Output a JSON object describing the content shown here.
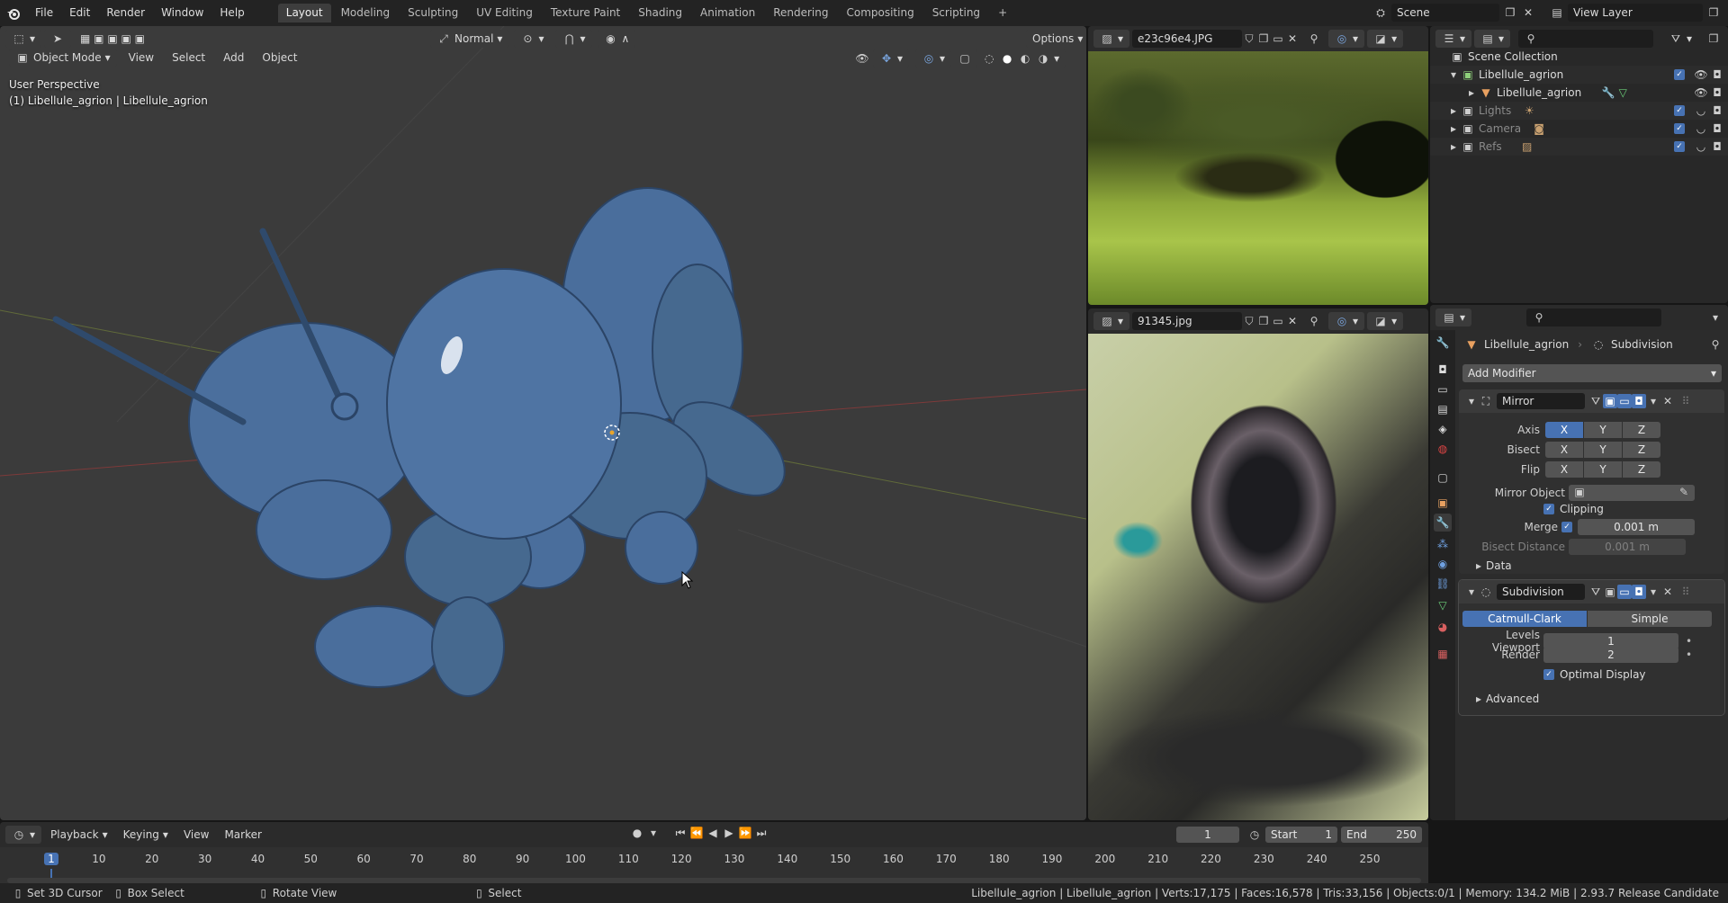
{
  "topbar": {
    "menu": [
      "File",
      "Edit",
      "Render",
      "Window",
      "Help"
    ],
    "workspaces": [
      "Layout",
      "Modeling",
      "Sculpting",
      "UV Editing",
      "Texture Paint",
      "Shading",
      "Animation",
      "Rendering",
      "Compositing",
      "Scripting"
    ],
    "active_workspace": "Layout",
    "add_tab": "+",
    "scene": "Scene",
    "view_layer": "View Layer"
  },
  "viewport": {
    "mode": "Object Mode",
    "menus": [
      "View",
      "Select",
      "Add",
      "Object"
    ],
    "orientation": "Normal",
    "options": "Options",
    "overlay_line1": "User Perspective",
    "overlay_line2": "(1) Libellule_agrion | Libellule_agrion"
  },
  "image_editor_top": {
    "filename": "e23c96e4.JPG"
  },
  "image_editor_bottom": {
    "filename": "91345.jpg"
  },
  "outliner": {
    "root": "Scene Collection",
    "items": [
      {
        "name": "Libellule_agrion",
        "kind": "collection"
      },
      {
        "name": "Libellule_agrion",
        "kind": "object"
      },
      {
        "name": "Lights",
        "kind": "collection"
      },
      {
        "name": "Camera",
        "kind": "collection"
      },
      {
        "name": "Refs",
        "kind": "collection"
      }
    ]
  },
  "properties": {
    "object_name": "Libellule_agrion",
    "modifier_context": "Subdivision",
    "add_modifier": "Add Modifier",
    "mirror": {
      "name": "Mirror",
      "axis_label": "Axis",
      "bisect_label": "Bisect",
      "flip_label": "Flip",
      "axes": [
        "X",
        "Y",
        "Z"
      ],
      "mirror_object_label": "Mirror Object",
      "clipping_label": "Clipping",
      "merge_label": "Merge",
      "merge_value": "0.001 m",
      "bisect_distance_label": "Bisect Distance",
      "bisect_distance_value": "0.001 m",
      "data_label": "Data"
    },
    "subdivision": {
      "name": "Subdivision",
      "catmull": "Catmull-Clark",
      "simple": "Simple",
      "levels_viewport_label": "Levels Viewport",
      "levels_viewport_value": "1",
      "render_label": "Render",
      "render_value": "2",
      "optimal_label": "Optimal Display",
      "advanced_label": "Advanced"
    }
  },
  "timeline": {
    "menus": [
      "Playback",
      "Keying",
      "View",
      "Marker"
    ],
    "current_frame": "1",
    "start_label": "Start",
    "start_value": "1",
    "end_label": "End",
    "end_value": "250",
    "ticks": [
      "1",
      "10",
      "20",
      "30",
      "40",
      "50",
      "60",
      "70",
      "80",
      "90",
      "100",
      "110",
      "120",
      "130",
      "140",
      "150",
      "160",
      "170",
      "180",
      "190",
      "200",
      "210",
      "220",
      "230",
      "240",
      "250"
    ]
  },
  "status": {
    "hints": [
      "Set 3D Cursor",
      "Box Select",
      "Rotate View",
      "Select"
    ],
    "stats": "Libellule_agrion | Libellule_agrion | Verts:17,175 | Faces:16,578 | Tris:33,156 | Objects:0/1 | Memory: 134.2 MiB | 2.93.7 Release Candidate"
  },
  "colors": {
    "accent": "#4772b3",
    "mesh": "#4a6e9c"
  }
}
